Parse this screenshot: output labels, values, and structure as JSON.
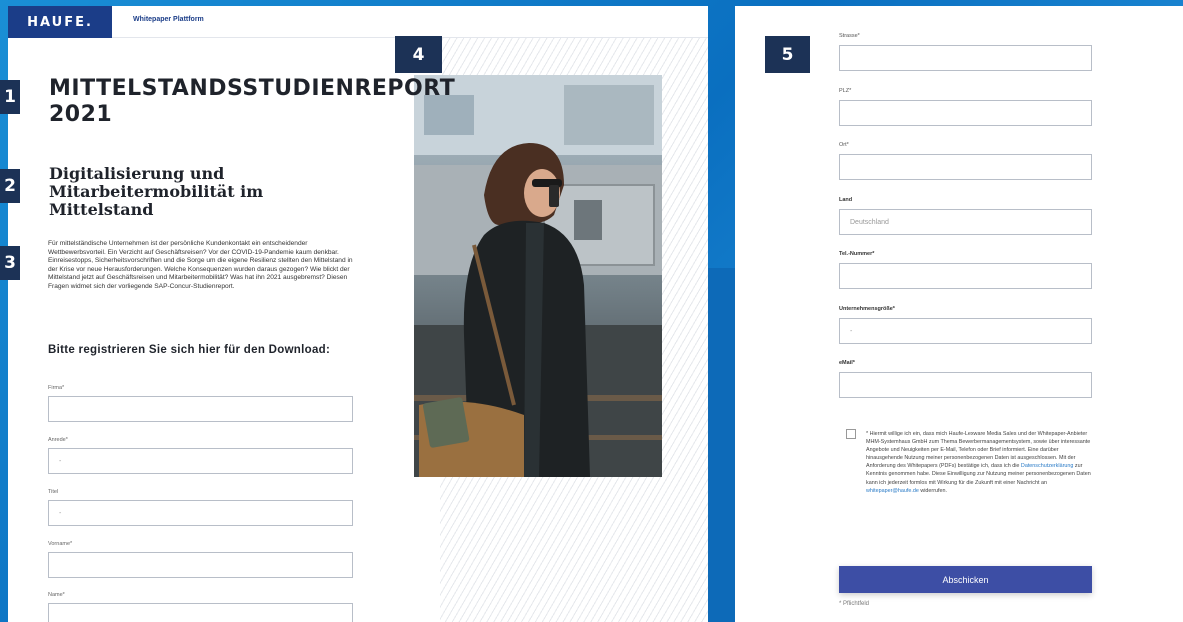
{
  "header": {
    "logo_text": "HAUFE.",
    "nav_link": "Whitepaper Plattform"
  },
  "badges": [
    "1",
    "2",
    "3",
    "4",
    "5"
  ],
  "main": {
    "title": "MITTELSTANDSSTUDIENREPORT 2021",
    "subtitle": "Digitalisierung und Mitarbeitermobilität im Mittelstand",
    "intro": "Für mittelständische Unternehmen ist der persönliche Kundenkontakt ein entscheidender Wettbewerbsvorteil. Ein Verzicht auf Geschäftsreisen? Vor der COVID-19-Pandemie kaum denkbar. Einreisestopps, Sicherheitsvorschriften und die Sorge um die eigene Resilienz stellten den Mittelstand in der Krise vor neue Herausforderungen. Welche Konsequenzen wurden daraus gezogen? Wie blickt der Mittelstand jetzt auf Geschäftsreisen und Mitarbeitermobilität? Was hat ihn 2021 ausgebremst? Diesen Fragen widmet sich der vorliegende SAP-Concur-Studienreport.",
    "form_heading": "Bitte registrieren Sie sich hier für den Download:"
  },
  "form_left": {
    "firma": {
      "label": "Firma*",
      "value": ""
    },
    "anrede": {
      "label": "Anrede*",
      "value": "-"
    },
    "titel": {
      "label": "Titel",
      "value": "-"
    },
    "vorname": {
      "label": "Vorname*",
      "value": ""
    },
    "name": {
      "label": "Name*",
      "value": ""
    }
  },
  "form_right": {
    "strasse": {
      "label": "Strasse*",
      "value": ""
    },
    "plz": {
      "label": "PLZ*",
      "value": ""
    },
    "ort": {
      "label": "Ort*",
      "value": ""
    },
    "land": {
      "label": "Land",
      "value": "Deutschland"
    },
    "tel": {
      "label": "Tel.-Nummer*",
      "value": ""
    },
    "groesse": {
      "label": "Unternehmensgröße*",
      "value": "-"
    },
    "email": {
      "label": "eMail*",
      "value": ""
    }
  },
  "consent": {
    "text_1": "* Hiermit willige ich ein, dass mich Haufe-Lexware Media Sales und der Whitepaper-Anbieter MHM-Systemhaus GmbH zum Thema Bewerbermanagementsystem, sowie über interessante Angebote und Neuigkeiten per E-Mail, Telefon oder Brief informiert. Eine darüber hinausgehende Nutzung meiner personenbezogenen Daten ist ausgeschlossen. Mit der Anforderung des Whitepapers (PDFs) bestätige ich, dass ich die",
    "privacy_link": "Datenschutzerklärung",
    "text_2": "zur Kenntnis genommen habe. Diese Einwilligung zur Nutzung meiner personenbezogenen Daten kann ich jederzeit formlos mit Wirkung für die Zukunft mit einer Nachricht an",
    "email_link": "whitepaper@haufe.de",
    "text_3": "widerrufen."
  },
  "submit_label": "Abschicken",
  "footnote": "* Pflichtfeld",
  "colors": {
    "brand_navy": "#1b3d88",
    "submit_button": "#3d4ea5",
    "badge": "#1c3256",
    "link": "#2a7bc7"
  }
}
